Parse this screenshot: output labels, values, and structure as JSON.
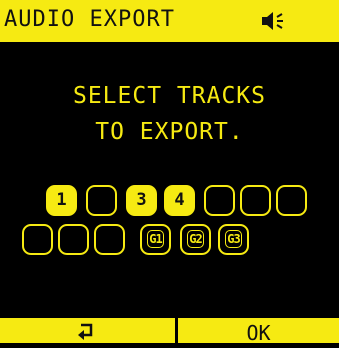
{
  "header": {
    "title": "AUDIO EXPORT",
    "icon": "speaker-icon"
  },
  "message": {
    "line1": "SELECT TRACKS",
    "line2": "TO EXPORT."
  },
  "tracks": {
    "row1": [
      {
        "label": "1",
        "selected": true
      },
      {
        "label": "",
        "selected": false
      },
      {
        "label": "3",
        "selected": true
      },
      {
        "label": "4",
        "selected": true
      },
      {
        "label": "",
        "selected": false
      },
      {
        "label": "",
        "selected": false
      },
      {
        "label": "",
        "selected": false
      }
    ],
    "row2": [
      {
        "label": "",
        "selected": false
      },
      {
        "label": "",
        "selected": false
      },
      {
        "label": "",
        "selected": false
      },
      {
        "label": "G1",
        "selected": false
      },
      {
        "label": "G2",
        "selected": false
      },
      {
        "label": "G3",
        "selected": false
      }
    ]
  },
  "footer": {
    "back_icon": "return-arrow-icon",
    "ok_label": "OK"
  },
  "colors": {
    "accent": "#f6ea12",
    "background": "#000000",
    "text_dark": "#111111"
  }
}
